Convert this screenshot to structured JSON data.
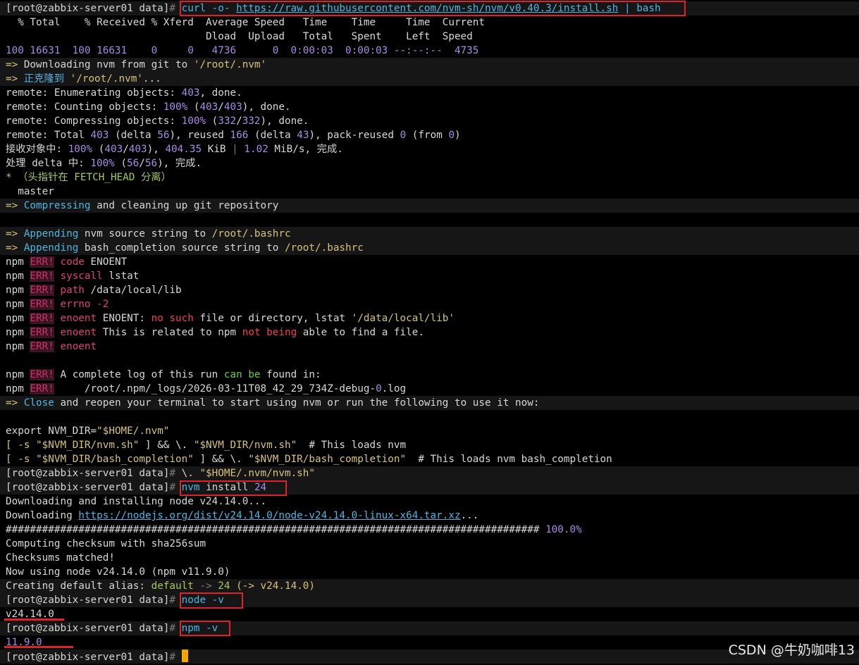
{
  "terminal": {
    "lines": [
      {
        "hl": true,
        "segs": [
          [
            "[root@zabbix-server01 data]",
            "w"
          ],
          [
            "# ",
            "dg"
          ],
          [
            "curl -o- ",
            "b"
          ],
          [
            "https://raw.githubusercontent.com/nvm-sh/nvm/v0.40.3/install.sh",
            "lnk"
          ],
          [
            " | bash",
            "b"
          ]
        ]
      },
      {
        "segs": [
          [
            "  % Total    % Received % Xferd  Average Speed   Time    Time     Time  Current",
            "w"
          ]
        ]
      },
      {
        "segs": [
          [
            "                                 Dload  Upload   Total   Spent    Left  Speed",
            "w"
          ]
        ]
      },
      {
        "segs": [
          [
            "100 16631  100 16631    0     0   4736      0  0:00:03  0:00:03 --:--:--  4735",
            "p"
          ]
        ]
      },
      {
        "hl": true,
        "segs": [
          [
            "=> ",
            "y"
          ],
          [
            "Downloading nvm from git to ",
            "w"
          ],
          [
            "'/root/.nvm'",
            "y"
          ]
        ]
      },
      {
        "hl": true,
        "segs": [
          [
            "=> ",
            "y"
          ],
          [
            "正克隆到 ",
            "b"
          ],
          [
            "'/root/.nvm'",
            "y"
          ],
          [
            "...",
            "w"
          ]
        ]
      },
      {
        "segs": [
          [
            "remote: Enumerating objects: ",
            "w"
          ],
          [
            "403",
            "p"
          ],
          [
            ", done.",
            "w"
          ]
        ]
      },
      {
        "segs": [
          [
            "remote: Counting objects: ",
            "w"
          ],
          [
            "100%",
            "p"
          ],
          [
            " (",
            "w"
          ],
          [
            "403",
            "p"
          ],
          [
            "/",
            "w"
          ],
          [
            "403",
            "p"
          ],
          [
            "), done.",
            "w"
          ]
        ]
      },
      {
        "segs": [
          [
            "remote: Compressing objects: ",
            "w"
          ],
          [
            "100%",
            "p"
          ],
          [
            " (",
            "w"
          ],
          [
            "332",
            "p"
          ],
          [
            "/",
            "w"
          ],
          [
            "332",
            "p"
          ],
          [
            "), done.",
            "w"
          ]
        ]
      },
      {
        "segs": [
          [
            "remote: Total ",
            "w"
          ],
          [
            "403",
            "p"
          ],
          [
            " (delta ",
            "w"
          ],
          [
            "56",
            "p"
          ],
          [
            "), reused ",
            "w"
          ],
          [
            "166",
            "p"
          ],
          [
            " (delta ",
            "w"
          ],
          [
            "43",
            "p"
          ],
          [
            "), pack-reused ",
            "w"
          ],
          [
            "0",
            "p"
          ],
          [
            " (from ",
            "w"
          ],
          [
            "0",
            "p"
          ],
          [
            ")",
            "w"
          ]
        ]
      },
      {
        "segs": [
          [
            "接收对象中: ",
            "w"
          ],
          [
            "100%",
            "p"
          ],
          [
            " (",
            "w"
          ],
          [
            "403",
            "p"
          ],
          [
            "/",
            "w"
          ],
          [
            "403",
            "p"
          ],
          [
            "), ",
            "w"
          ],
          [
            "404.35",
            "p"
          ],
          [
            " KiB ",
            "w"
          ],
          [
            "|",
            "dg"
          ],
          [
            " ",
            "w"
          ],
          [
            "1.02",
            "p"
          ],
          [
            " MiB/s, 完成.",
            "w"
          ]
        ]
      },
      {
        "segs": [
          [
            "处理 delta 中: ",
            "w"
          ],
          [
            "100%",
            "p"
          ],
          [
            " (",
            "w"
          ],
          [
            "56",
            "p"
          ],
          [
            "/",
            "w"
          ],
          [
            "56",
            "p"
          ],
          [
            "), 完成.",
            "w"
          ]
        ]
      },
      {
        "segs": [
          [
            "* （头指针在 FETCH_HEAD 分离）",
            "g"
          ]
        ]
      },
      {
        "segs": [
          [
            "  master",
            "w"
          ]
        ]
      },
      {
        "hl": true,
        "segs": [
          [
            "=> ",
            "y"
          ],
          [
            "Compressing",
            "b"
          ],
          [
            " and cleaning up git repository",
            "w"
          ]
        ]
      },
      {
        "segs": []
      },
      {
        "hl": true,
        "segs": [
          [
            "=> ",
            "y"
          ],
          [
            "Appending",
            "b"
          ],
          [
            " nvm source string to ",
            "w"
          ],
          [
            "/root/.bashrc",
            "y"
          ]
        ]
      },
      {
        "hl": true,
        "segs": [
          [
            "=> ",
            "y"
          ],
          [
            "Appending",
            "b"
          ],
          [
            " bash_completion source string to ",
            "w"
          ],
          [
            "/root/.bashrc",
            "y"
          ]
        ]
      },
      {
        "segs": [
          [
            "npm ",
            "w"
          ],
          [
            "ERR!",
            "err"
          ],
          [
            " ",
            "w"
          ],
          [
            "code",
            "pk"
          ],
          [
            " ENOENT",
            "w"
          ]
        ]
      },
      {
        "segs": [
          [
            "npm ",
            "w"
          ],
          [
            "ERR!",
            "err"
          ],
          [
            " ",
            "w"
          ],
          [
            "syscall",
            "pk"
          ],
          [
            " lstat",
            "w"
          ]
        ]
      },
      {
        "segs": [
          [
            "npm ",
            "w"
          ],
          [
            "ERR!",
            "err"
          ],
          [
            " ",
            "w"
          ],
          [
            "path",
            "pk"
          ],
          [
            " /data/local/lib",
            "w"
          ]
        ]
      },
      {
        "segs": [
          [
            "npm ",
            "w"
          ],
          [
            "ERR!",
            "err"
          ],
          [
            " ",
            "w"
          ],
          [
            "errno",
            "pk"
          ],
          [
            " ",
            "w"
          ],
          [
            "-2",
            "pk"
          ]
        ]
      },
      {
        "segs": [
          [
            "npm ",
            "w"
          ],
          [
            "ERR!",
            "err"
          ],
          [
            " ",
            "w"
          ],
          [
            "enoent",
            "pk"
          ],
          [
            " ENOENT: ",
            "w"
          ],
          [
            "no such",
            "r"
          ],
          [
            " file or directory, lstat ",
            "w"
          ],
          [
            "'/data/local/lib'",
            "y"
          ]
        ]
      },
      {
        "segs": [
          [
            "npm ",
            "w"
          ],
          [
            "ERR!",
            "err"
          ],
          [
            " ",
            "w"
          ],
          [
            "enoent",
            "pk"
          ],
          [
            " This is related to npm ",
            "w"
          ],
          [
            "not being",
            "r"
          ],
          [
            " able to find a file.",
            "w"
          ]
        ]
      },
      {
        "segs": [
          [
            "npm ",
            "w"
          ],
          [
            "ERR!",
            "err"
          ],
          [
            " ",
            "w"
          ],
          [
            "enoent",
            "pk"
          ]
        ]
      },
      {
        "segs": []
      },
      {
        "segs": [
          [
            "npm ",
            "w"
          ],
          [
            "ERR!",
            "err"
          ],
          [
            " A complete log of this run ",
            "w"
          ],
          [
            "can be",
            "gb"
          ],
          [
            " found in:",
            "w"
          ]
        ]
      },
      {
        "segs": [
          [
            "npm ",
            "w"
          ],
          [
            "ERR!",
            "err"
          ],
          [
            "     /root/.npm/_logs/2026-03-11T08_42_29_734Z-debug-",
            "w"
          ],
          [
            "0",
            "p"
          ],
          [
            ".log",
            "w"
          ]
        ]
      },
      {
        "hl": true,
        "segs": [
          [
            "=> ",
            "y"
          ],
          [
            "Close",
            "b"
          ],
          [
            " and reopen your terminal to start using nvm or run the following to use it now:",
            "w"
          ]
        ]
      },
      {
        "segs": []
      },
      {
        "segs": [
          [
            "export NVM_DIR=",
            "w"
          ],
          [
            "\"$HOME/.nvm\"",
            "y"
          ]
        ]
      },
      {
        "segs": [
          [
            "[ -s ",
            "y"
          ],
          [
            "\"$NVM_DIR/nvm.sh\"",
            "y"
          ],
          [
            " ] && \\. ",
            "w"
          ],
          [
            "\"$NVM_DIR/nvm.sh\"",
            "y"
          ],
          [
            "  # This loads nvm",
            "w"
          ]
        ]
      },
      {
        "segs": [
          [
            "[ -s ",
            "y"
          ],
          [
            "\"$NVM_DIR/bash_completion\"",
            "y"
          ],
          [
            " ] && \\. ",
            "w"
          ],
          [
            "\"$NVM_DIR/bash_completion\"",
            "y"
          ],
          [
            "  # This loads nvm bash_completion",
            "w"
          ]
        ]
      },
      {
        "hl": true,
        "segs": [
          [
            "[root@zabbix-server01 data]",
            "w"
          ],
          [
            "# ",
            "dg"
          ],
          [
            "\\. ",
            "w"
          ],
          [
            "\"$HOME/.nvm/nvm.sh\"",
            "y"
          ]
        ]
      },
      {
        "hl": true,
        "segs": [
          [
            "[root@zabbix-server01 data]",
            "w"
          ],
          [
            "# ",
            "dg"
          ],
          [
            "nvm ",
            "b"
          ],
          [
            "install ",
            "w"
          ],
          [
            "24",
            "p"
          ]
        ]
      },
      {
        "segs": [
          [
            "Downloading and installing node v24.14.0...",
            "w"
          ]
        ]
      },
      {
        "segs": [
          [
            "Downloading ",
            "w"
          ],
          [
            "https://nodejs.org/dist/v24.14.0/node-v24.14.0-linux-x64.tar.xz",
            "lnk"
          ],
          [
            "...",
            "w"
          ]
        ]
      },
      {
        "segs": [
          [
            "######################################################################################## ",
            "w"
          ],
          [
            "100.0%",
            "p"
          ]
        ]
      },
      {
        "segs": [
          [
            "Computing checksum with sha256sum",
            "w"
          ]
        ]
      },
      {
        "segs": [
          [
            "Checksums matched!",
            "w"
          ]
        ]
      },
      {
        "segs": [
          [
            "Now using node v24.14.0 (npm v11.9.0)",
            "w"
          ]
        ]
      },
      {
        "hl": true,
        "segs": [
          [
            "Creating default alias: ",
            "w"
          ],
          [
            "default",
            "g"
          ],
          [
            " -> ",
            "dg"
          ],
          [
            "24",
            "g"
          ],
          [
            " (-> v24.14.0)",
            "y"
          ]
        ]
      },
      {
        "hl": true,
        "segs": [
          [
            "[root@zabbix-server01 data]",
            "w"
          ],
          [
            "# ",
            "dg"
          ],
          [
            "node -v",
            "b"
          ]
        ]
      },
      {
        "segs": [
          [
            "v24.14.0",
            "w"
          ]
        ]
      },
      {
        "hl": true,
        "segs": [
          [
            "[root@zabbix-server01 data]",
            "w"
          ],
          [
            "# ",
            "dg"
          ],
          [
            "npm -v",
            "b"
          ]
        ]
      },
      {
        "segs": [
          [
            "11.9.0",
            "p"
          ]
        ]
      },
      {
        "hl": true,
        "cursor": true,
        "segs": [
          [
            "[root@zabbix-server01 data]",
            "w"
          ],
          [
            "# ",
            "dg"
          ]
        ]
      }
    ]
  },
  "watermark": "CSDN @牛奶咖啡13",
  "colors": {
    "background": "#000000",
    "text": "#d7d7d7",
    "purple_numbers": "#a98ae3",
    "blue_commands": "#4fb6e1",
    "yellow_strings": "#d6c37a",
    "green": "#a7c957",
    "error_red": "#f0404f",
    "annotation_red": "#e0202a",
    "cursor": "#f2a600"
  }
}
